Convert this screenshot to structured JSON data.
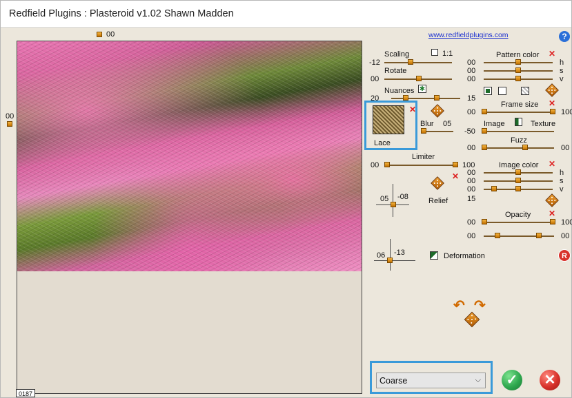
{
  "window": {
    "title": "Redfield Plugins : Plasteroid v1.02   Shawn Madden"
  },
  "link": "www.redfieldplugins.com",
  "help_icon": "?",
  "preview": {
    "top_value": "00",
    "left_value": "00",
    "scroll_value": "0187"
  },
  "scaling": {
    "label": "Scaling",
    "check_label": "1:1",
    "value": "-12",
    "level": 0.45
  },
  "rotate": {
    "label": "Rotate",
    "value": "00",
    "level": 0.5
  },
  "nuances": {
    "label": "Nuances",
    "min": "20",
    "max": "15"
  },
  "texture": {
    "name": "Lace",
    "blur_label": "Blur",
    "blur_value": "05"
  },
  "limiter": {
    "label": "Limiter",
    "min": "00",
    "max": "100"
  },
  "relief": {
    "label": "Relief",
    "x": "05",
    "y": "-08"
  },
  "deformation": {
    "label": "Deformation",
    "x": "06",
    "y": "-13"
  },
  "pattern_color": {
    "label": "Pattern color",
    "h": "00",
    "s": "00",
    "v": "00",
    "h_label": "h",
    "s_label": "s",
    "v_label": "v"
  },
  "frame_size": {
    "label": "Frame size",
    "min": "00",
    "max": "100"
  },
  "image_texture": {
    "left_label": "Image",
    "right_label": "Texture",
    "value": "-50"
  },
  "fuzz": {
    "label": "Fuzz",
    "min": "00",
    "max": "00"
  },
  "image_color": {
    "label": "Image color",
    "h": "00",
    "s": "00",
    "v": "00",
    "h_label": "h",
    "s_label": "s",
    "v_label": "v",
    "extra": "15"
  },
  "opacity": {
    "label": "Opacity",
    "min": "00",
    "max": "100",
    "min2": "00",
    "max2": "00"
  },
  "reset_label": "R",
  "quality": {
    "selected": "Coarse"
  },
  "buttons": {
    "ok": "✓",
    "cancel": "✕"
  },
  "colors": {
    "accent": "#3a9ad9",
    "ok": "#2fa84f",
    "cancel": "#d8322b"
  }
}
